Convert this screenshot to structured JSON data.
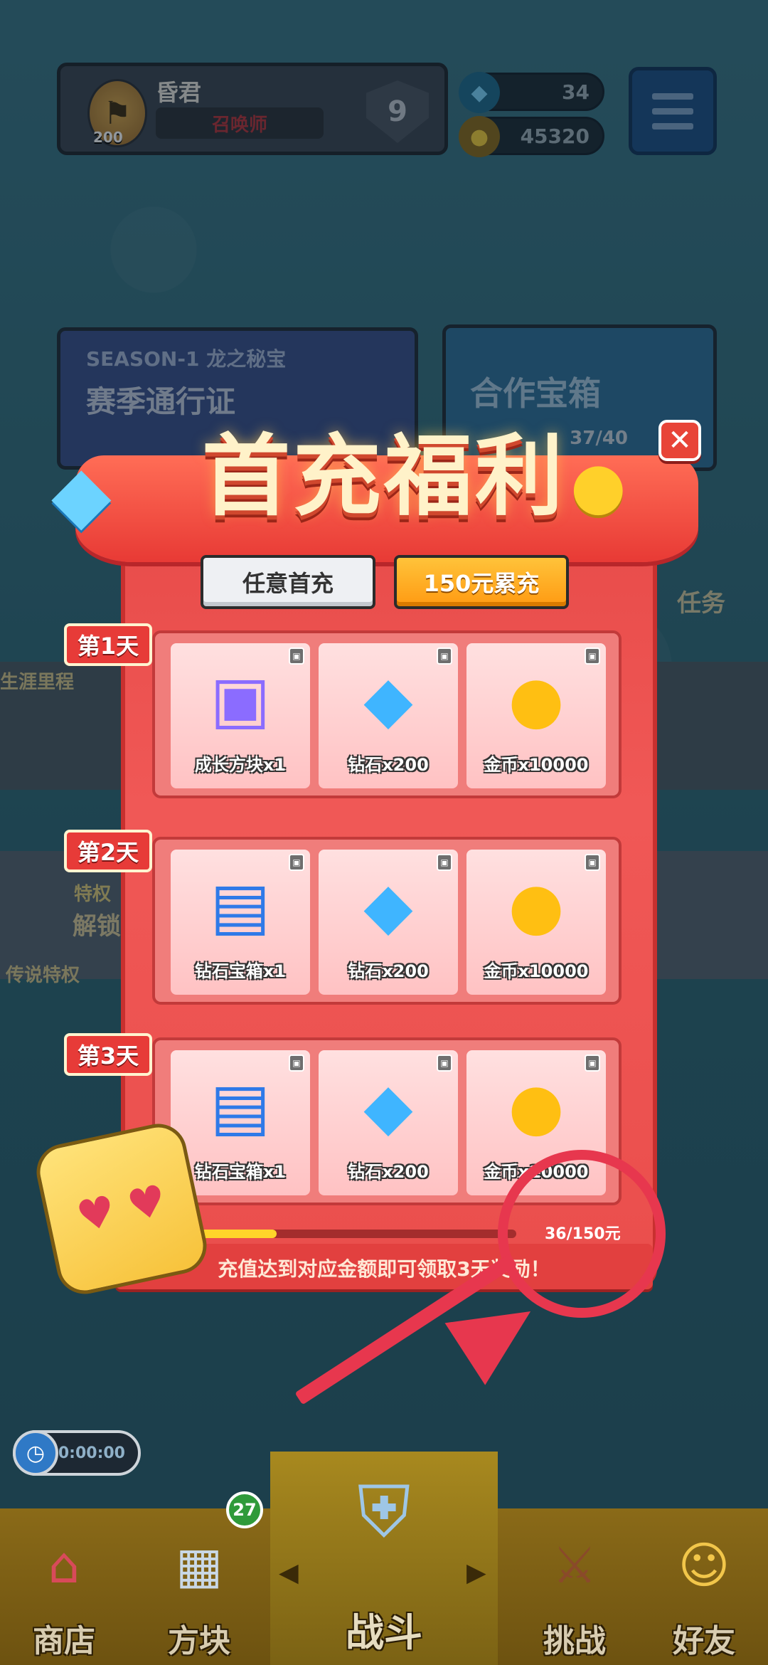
{
  "header": {
    "player_name": "昏君",
    "player_title": "召唤师",
    "avatar_level": "200",
    "rank_level": "9",
    "gems": "34",
    "coins": "45320"
  },
  "background": {
    "season_title": "SEASON-1 龙之秘宝",
    "season_subtitle": "赛季通行证",
    "coop_title": "合作宝箱",
    "coop_count": "37/40",
    "task_label": "任务",
    "career_label": "生涯里程",
    "special_label": "特权",
    "unlock_label": "解锁",
    "legend_label": "传说特权"
  },
  "popup": {
    "title": "首充福利",
    "close_label": "✕",
    "tabs": [
      {
        "label": "任意首充",
        "active": false
      },
      {
        "label": "150元累充",
        "active": true
      }
    ],
    "days": [
      {
        "tag": "第1天",
        "rewards": [
          {
            "icon": "block-icon",
            "name": "成长方块x1"
          },
          {
            "icon": "gem-icon",
            "name": "钻石x200"
          },
          {
            "icon": "coin-pile-icon",
            "name": "金币x10000"
          }
        ]
      },
      {
        "tag": "第2天",
        "rewards": [
          {
            "icon": "chest-icon",
            "name": "钻石宝箱x1"
          },
          {
            "icon": "gem-icon",
            "name": "钻石x200"
          },
          {
            "icon": "coin-pile-icon",
            "name": "金币x10000"
          }
        ]
      },
      {
        "tag": "第3天",
        "rewards": [
          {
            "icon": "chest-icon",
            "name": "钻石宝箱x1"
          },
          {
            "icon": "gem-icon",
            "name": "钻石x200"
          },
          {
            "icon": "coin-pile-icon",
            "name": "金币x10000"
          }
        ]
      }
    ],
    "progress_text": "36/150元",
    "progress_fraction": 0.24,
    "hint": "充值达到对应金额即可领取3天奖励！"
  },
  "timer": "00:00:00",
  "nav": {
    "items": [
      {
        "label": "商店",
        "icon": "shop-icon"
      },
      {
        "label": "方块",
        "icon": "block-box-icon",
        "badge": "27"
      },
      {
        "label": "战斗",
        "icon": "battle-icon"
      },
      {
        "label": "挑战",
        "icon": "challenge-icon"
      },
      {
        "label": "好友",
        "icon": "friends-icon"
      }
    ],
    "prev_arrow": "◀",
    "next_arrow": "▶"
  },
  "colors": {
    "popup_red": "#e74a48",
    "accent_gold": "#ffd52a",
    "annotation_red": "#e7374e"
  }
}
